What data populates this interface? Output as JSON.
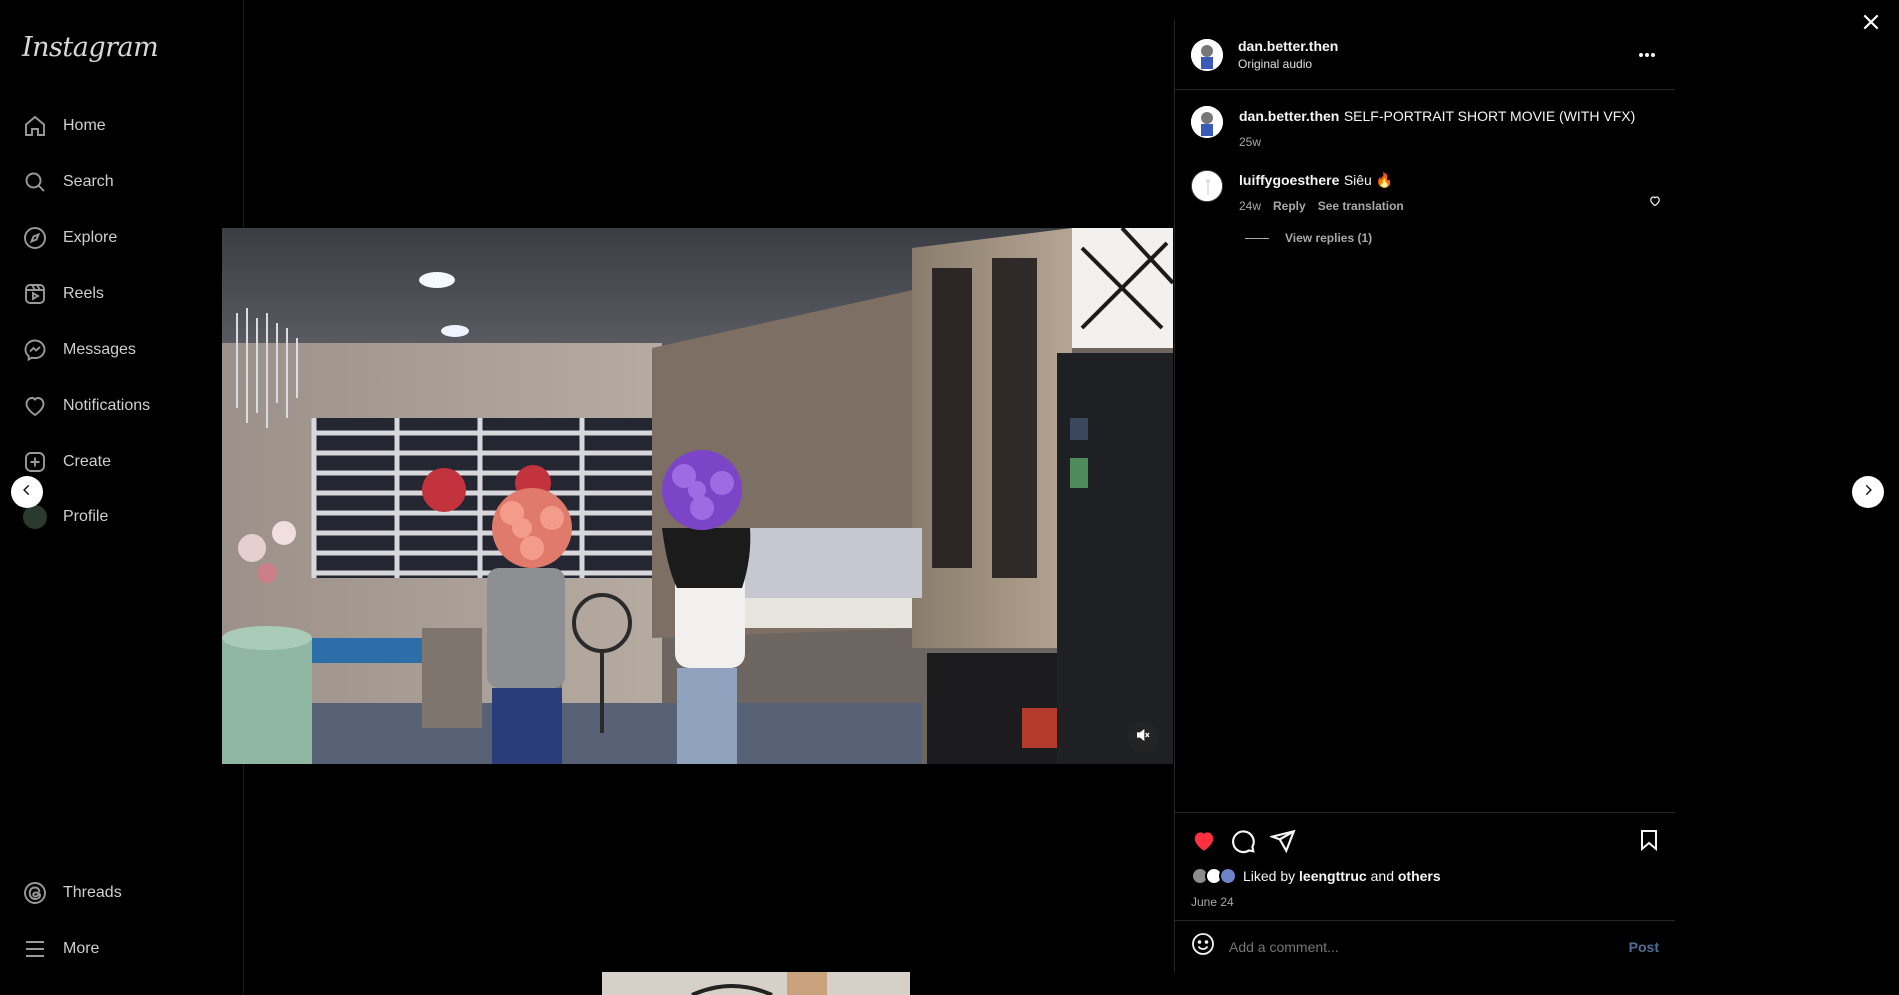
{
  "app": {
    "logo": "Instagram"
  },
  "nav": {
    "home": "Home",
    "search": "Search",
    "explore": "Explore",
    "reels": "Reels",
    "messages": "Messages",
    "notifications": "Notifications",
    "create": "Create",
    "profile": "Profile",
    "threads": "Threads",
    "more": "More"
  },
  "post": {
    "author": "dan.better.then",
    "audio": "Original audio",
    "caption_user": "dan.better.then",
    "caption_text": "SELF-PORTRAIT SHORT MOVIE (WITH VFX)",
    "caption_age": "25w"
  },
  "comments": [
    {
      "user": "luiffygoesthere",
      "text": "Siêu 🔥",
      "age": "24w",
      "reply_label": "Reply",
      "translate_label": "See translation",
      "view_replies": "View replies (1)"
    }
  ],
  "likes": {
    "prefix": "Liked by",
    "user": "leengttruc",
    "conj": "and",
    "others": "others",
    "date": "June 24"
  },
  "comment_input": {
    "placeholder": "Add a comment...",
    "post_label": "Post"
  },
  "colors": {
    "like_active": "#ff3040",
    "link_blue": "#0095f6"
  },
  "icons": [
    "home-icon",
    "search-icon",
    "explore-icon",
    "reels-icon",
    "messages-icon",
    "notifications-icon",
    "create-icon",
    "threads-icon",
    "more-icon",
    "close-icon",
    "chevron-left-icon",
    "chevron-right-icon",
    "more-options-icon",
    "heart-icon",
    "comment-icon",
    "share-icon",
    "bookmark-icon",
    "emoji-icon",
    "mute-icon"
  ]
}
